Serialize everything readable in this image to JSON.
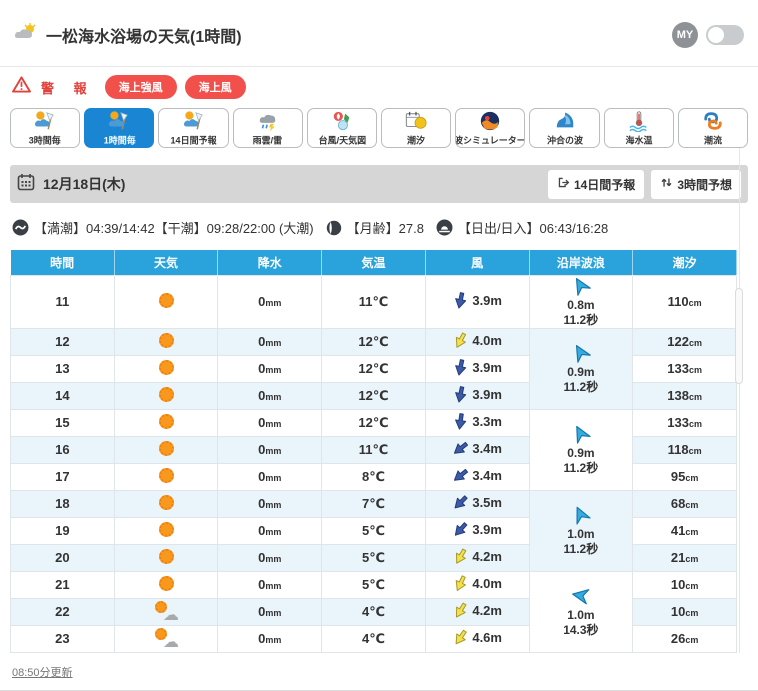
{
  "header": {
    "title": "一松海水浴場の天気(1時間)",
    "my_label": "MY"
  },
  "warning": {
    "label": "警 報",
    "badges": [
      "海上強風",
      "海上風"
    ]
  },
  "tabs": [
    {
      "id": "3hourly",
      "label": "3時間毎",
      "icon": "forecast-icon",
      "active": false
    },
    {
      "id": "1hourly",
      "label": "1時間毎",
      "icon": "forecast-icon",
      "active": true
    },
    {
      "id": "14day",
      "label": "14日間予報",
      "icon": "forecast-icon",
      "active": false
    },
    {
      "id": "raincloud",
      "label": "雨雲/雷",
      "icon": "raincloud-icon",
      "active": false
    },
    {
      "id": "typhoon",
      "label": "台風/天気図",
      "icon": "typhoon-icon",
      "active": false
    },
    {
      "id": "tide",
      "label": "潮汐",
      "icon": "tide-icon",
      "active": false
    },
    {
      "id": "wavesim",
      "label": "波シミュレーター",
      "icon": "wavesim-icon",
      "active": false
    },
    {
      "id": "offshore",
      "label": "沖合の波",
      "icon": "offshore-wave-icon",
      "active": false
    },
    {
      "id": "seatemp",
      "label": "海水温",
      "icon": "seatemp-icon",
      "active": false
    },
    {
      "id": "current",
      "label": "潮流",
      "icon": "current-icon",
      "active": false
    }
  ],
  "datebar": {
    "date": "12月18日(木)",
    "buttons": [
      {
        "id": "14day-forecast",
        "label": "14日間予報",
        "icon": "external-icon"
      },
      {
        "id": "3hour-forecast",
        "label": "3時間予想",
        "icon": "swap-icon"
      }
    ]
  },
  "tideinfo": {
    "segments": [
      {
        "icon": "tide-cycle-icon",
        "text": "【満潮】04:39/14:42【干潮】09:28/22:00 (大潮)"
      },
      {
        "icon": "moon-icon",
        "text": "【月齢】27.8"
      },
      {
        "icon": "sunrise-icon",
        "text": "【日出/日入】06:43/16:28"
      }
    ]
  },
  "table": {
    "headers": [
      "時間",
      "天気",
      "降水",
      "気温",
      "風",
      "沿岸波浪",
      "潮汐"
    ],
    "units": {
      "precip": "mm",
      "tide": "cm"
    },
    "rows": [
      {
        "time": "11",
        "weather": "sunny",
        "precip": "0",
        "temp": "11℃",
        "wind": "3.9m",
        "wind_color": "blue",
        "wind_dir": 12,
        "tide": "110"
      },
      {
        "time": "12",
        "weather": "sunny",
        "precip": "0",
        "temp": "12℃",
        "wind": "4.0m",
        "wind_color": "yellow",
        "wind_dir": 28,
        "tide": "122"
      },
      {
        "time": "13",
        "weather": "sunny",
        "precip": "0",
        "temp": "12℃",
        "wind": "3.9m",
        "wind_color": "blue",
        "wind_dir": 12,
        "tide": "133"
      },
      {
        "time": "14",
        "weather": "sunny",
        "precip": "0",
        "temp": "12℃",
        "wind": "3.9m",
        "wind_color": "blue",
        "wind_dir": 12,
        "tide": "138"
      },
      {
        "time": "15",
        "weather": "sunny",
        "precip": "0",
        "temp": "12℃",
        "wind": "3.3m",
        "wind_color": "blue",
        "wind_dir": 8,
        "tide": "133"
      },
      {
        "time": "16",
        "weather": "sunny",
        "precip": "0",
        "temp": "11℃",
        "wind": "3.4m",
        "wind_color": "blue",
        "wind_dir": 52,
        "tide": "118"
      },
      {
        "time": "17",
        "weather": "sunny",
        "precip": "0",
        "temp": "8℃",
        "wind": "3.4m",
        "wind_color": "blue",
        "wind_dir": 52,
        "tide": "95"
      },
      {
        "time": "18",
        "weather": "sunny",
        "precip": "0",
        "temp": "7℃",
        "wind": "3.5m",
        "wind_color": "blue",
        "wind_dir": 45,
        "tide": "68"
      },
      {
        "time": "19",
        "weather": "sunny",
        "precip": "0",
        "temp": "5℃",
        "wind": "3.9m",
        "wind_color": "blue",
        "wind_dir": 42,
        "tide": "41"
      },
      {
        "time": "20",
        "weather": "sunny",
        "precip": "0",
        "temp": "5℃",
        "wind": "4.2m",
        "wind_color": "yellow",
        "wind_dir": 30,
        "tide": "21"
      },
      {
        "time": "21",
        "weather": "sunny",
        "precip": "0",
        "temp": "5℃",
        "wind": "4.0m",
        "wind_color": "yellow",
        "wind_dir": 25,
        "tide": "10"
      },
      {
        "time": "22",
        "weather": "sun-cloud",
        "precip": "0",
        "temp": "4℃",
        "wind": "4.2m",
        "wind_color": "yellow",
        "wind_dir": 32,
        "tide": "10"
      },
      {
        "time": "23",
        "weather": "sun-cloud",
        "precip": "0",
        "temp": "4℃",
        "wind": "4.6m",
        "wind_color": "yellow",
        "wind_dir": 35,
        "tide": "26"
      }
    ],
    "wave_groups": [
      {
        "start": 0,
        "span": 1,
        "height": "0.8m",
        "period": "11.2秒",
        "dir": -30
      },
      {
        "start": 1,
        "span": 3,
        "height": "0.9m",
        "period": "11.2秒",
        "dir": -30
      },
      {
        "start": 4,
        "span": 3,
        "height": "0.9m",
        "period": "11.2秒",
        "dir": -28
      },
      {
        "start": 7,
        "span": 3,
        "height": "1.0m",
        "period": "11.2秒",
        "dir": -25
      },
      {
        "start": 10,
        "span": 3,
        "height": "1.0m",
        "period": "14.3秒",
        "dir": -80
      }
    ]
  },
  "footer": {
    "updated": "08:50分更新"
  },
  "colors": {
    "accent_blue": "#1a86d3",
    "table_header_blue": "#2aa2dc",
    "stripe_blue": "#eaf4fb",
    "alert_red": "#f2504b",
    "wind_blue": "#3b5aa8",
    "wind_yellow": "#f3e04d",
    "wave_cyan": "#36abe0",
    "sun_orange": "#f8991d"
  }
}
